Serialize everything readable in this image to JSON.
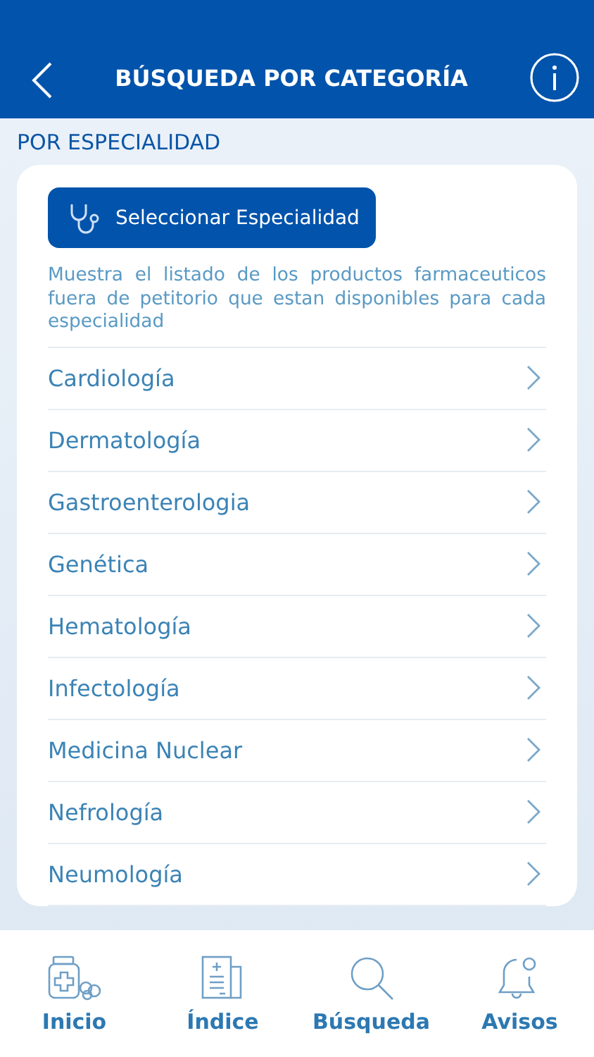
{
  "header": {
    "title": "BÚSQUEDA POR CATEGORÍA"
  },
  "section_title": "POR ESPECIALIDAD",
  "select_button": "Seleccionar Especialidad",
  "description": "Muestra el listado de los productos farmaceuticos fuera de petitorio que estan disponibles para cada especialidad",
  "specialties": [
    "Cardiología",
    "Dermatología",
    "Gastroenterologia",
    "Genética",
    "Hematología",
    "Infectología",
    "Medicina Nuclear",
    "Nefrología",
    "Neumología"
  ],
  "tab_bar": [
    {
      "kind": "home",
      "label": "Inicio"
    },
    {
      "kind": "index",
      "label": "Índice"
    },
    {
      "kind": "search",
      "label": "Búsqueda"
    },
    {
      "kind": "alerts",
      "label": "Avisos"
    }
  ]
}
